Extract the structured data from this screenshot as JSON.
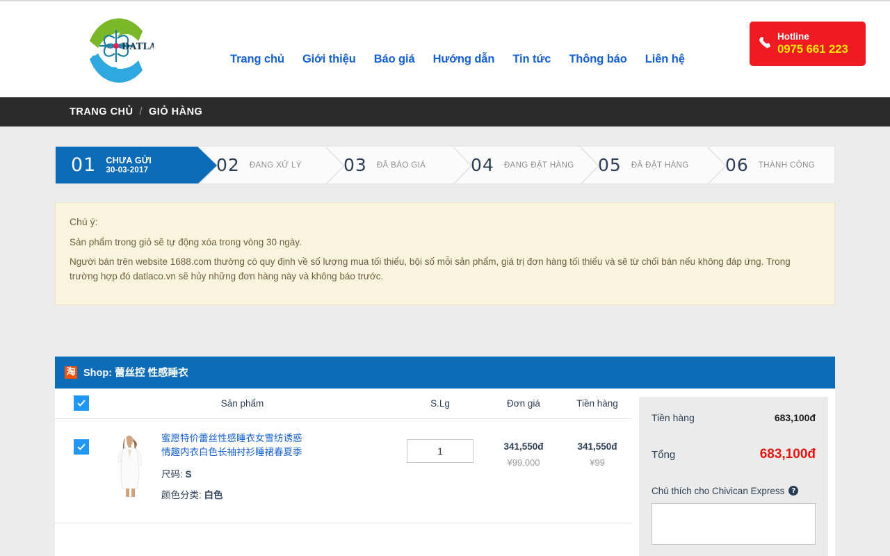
{
  "header": {
    "logo_text": "DATLACO",
    "nav": [
      {
        "label": "Trang chủ"
      },
      {
        "label": "Giới thiệu"
      },
      {
        "label": "Báo giá"
      },
      {
        "label": "Hướng dẫn"
      },
      {
        "label": "Tin tức"
      },
      {
        "label": "Thông báo"
      },
      {
        "label": "Liên hệ"
      }
    ],
    "hotline": {
      "label": "Hotline",
      "number": "0975 661 223",
      "bg_color": "#ee1c22",
      "number_color": "#ffe400"
    }
  },
  "breadcrumb": {
    "home": "TRANG CHỦ",
    "separator": "/",
    "current": "GIỎ HÀNG"
  },
  "steps": [
    {
      "num": "01",
      "label": "CHƯA GỬI",
      "date": "30-03-2017",
      "active": true
    },
    {
      "num": "02",
      "label": "ĐANG XỬ LÝ",
      "active": false
    },
    {
      "num": "03",
      "label": "ĐÃ BÁO GIÁ",
      "active": false
    },
    {
      "num": "04",
      "label": "ĐANG ĐẶT HÀNG",
      "active": false
    },
    {
      "num": "05",
      "label": "ĐÃ ĐẶT HÀNG",
      "active": false
    },
    {
      "num": "06",
      "label": "THÀNH CÔNG",
      "active": false
    }
  ],
  "notice": {
    "title": "Chú ý:",
    "line1": "Sản phẩm trong giỏ sẽ tự động xóa trong vòng 30 ngày.",
    "line2": "Người bán trên website 1688.com thường có quy định về số lượng mua tối thiểu, bội số mỗi sản phẩm, giá trị đơn hàng tối thiểu và sẽ từ chối bán nếu không đáp ứng. Trong trường hợp đó datlaco.vn sẽ hủy những đơn hàng này và không báo trước."
  },
  "cart": {
    "shop": {
      "icon_glyph": "淘",
      "prefix": "Shop:",
      "name": "蕾丝控 性感睡衣"
    },
    "columns": {
      "product": "Sản phẩm",
      "qty": "S.Lg",
      "unit_price": "Đơn giá",
      "amount": "Tiền hàng"
    },
    "rows": [
      {
        "checked": true,
        "title": "蜜愿特价蕾丝性感睡衣女雪纺诱惑情趣内衣白色长袖衬衫睡裙春夏季",
        "size_label": "尺码:",
        "size_value": "S",
        "color_label": "颜色分类:",
        "color_value": "白色",
        "qty": "1",
        "unit_price_vnd": "341,550đ",
        "unit_price_cny": "¥99.000",
        "amount_vnd": "341,550đ",
        "amount_cny": "¥99"
      }
    ]
  },
  "summary": {
    "subtotal_label": "Tiền hàng",
    "subtotal_value": "683,100đ",
    "total_label": "Tổng",
    "total_value": "683,100đ",
    "total_color": "#e8120c",
    "note_label": "Chú thích cho Chivican Express",
    "note_help_glyph": "?",
    "note_value": "",
    "note_placeholder": ""
  }
}
